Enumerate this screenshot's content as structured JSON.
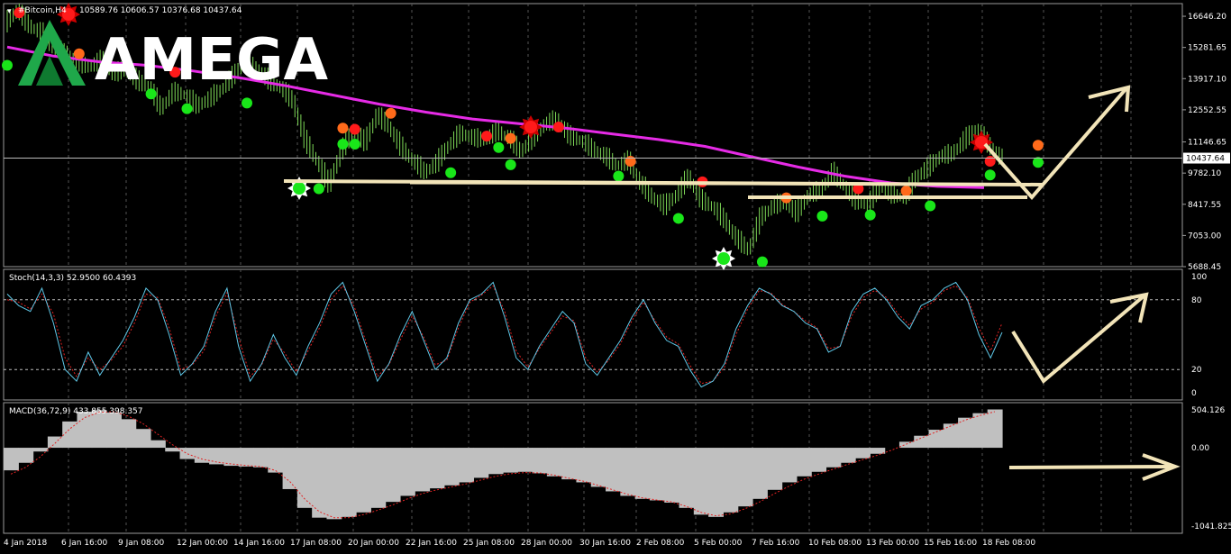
{
  "chart_data": [
    {
      "type": "candlestick",
      "symbol_label": "#Bitcoin,H4",
      "ohlc_text": "10589.76 10606.57 10376.68 10437.64",
      "current_price": "10437.64",
      "logo": {
        "text": "AMEGA",
        "accent": "#1fa84a"
      },
      "yaxis": {
        "ticks": [
          "16646.20",
          "15281.65",
          "13917.10",
          "12552.55",
          "11146.65",
          "9782.10",
          "8417.55",
          "7053.00",
          "5688.45"
        ],
        "range": [
          5688.45,
          17200
        ]
      },
      "price_series": [
        16300,
        16900,
        16200,
        15900,
        15200,
        15000,
        14600,
        14400,
        14700,
        14100,
        14300,
        13800,
        13500,
        12600,
        13300,
        13200,
        12700,
        13000,
        13400,
        14000,
        14600,
        14300,
        13800,
        13500,
        12900,
        11200,
        10300,
        9250,
        10700,
        11600,
        11100,
        12300,
        11800,
        10900,
        10300,
        9800,
        10200,
        11000,
        11500,
        11300,
        11200,
        11600,
        11300,
        10700,
        11300,
        11900,
        12100,
        11400,
        11200,
        10800,
        10500,
        10100,
        10300,
        9300,
        8700,
        8300,
        8800,
        9600,
        8600,
        8300,
        7700,
        6900,
        6400,
        7800,
        8300,
        8500,
        8000,
        8800,
        9000,
        9800,
        9200,
        8500,
        8400,
        9200,
        8800,
        8700,
        9600,
        10000,
        10500,
        10600,
        11200,
        11700,
        11000,
        10437
      ],
      "ma_series": [
        15300,
        14900,
        14650,
        14500,
        14250,
        13950,
        13600,
        13200,
        12800,
        12450,
        12150,
        11950,
        11750,
        11500,
        11250,
        10950,
        10500,
        10050,
        9650,
        9350,
        9200,
        9150
      ],
      "buy_signals": [
        {
          "i": 0,
          "p": 14500
        },
        {
          "i": 12,
          "p": 13250
        },
        {
          "i": 15,
          "p": 12600
        },
        {
          "i": 20,
          "p": 12850
        },
        {
          "i": 26,
          "p": 9100
        },
        {
          "i": 28,
          "p": 11050
        },
        {
          "i": 29,
          "p": 11050
        },
        {
          "i": 37,
          "p": 9800
        },
        {
          "i": 41,
          "p": 10900
        },
        {
          "i": 42,
          "p": 10150
        },
        {
          "i": 51,
          "p": 9650
        },
        {
          "i": 56,
          "p": 7800
        },
        {
          "i": 63,
          "p": 5900
        },
        {
          "i": 68,
          "p": 7900
        },
        {
          "i": 72,
          "p": 7950
        },
        {
          "i": 77,
          "p": 8350
        },
        {
          "i": 82,
          "p": 9700
        },
        {
          "i": 86,
          "p": 10250
        }
      ],
      "sell_signals": [
        {
          "i": 1,
          "p": 16800
        },
        {
          "i": 6,
          "p": 15000
        },
        {
          "i": 14,
          "p": 14200
        },
        {
          "i": 28,
          "p": 11750
        },
        {
          "i": 29,
          "p": 11700
        },
        {
          "i": 32,
          "p": 12400
        },
        {
          "i": 40,
          "p": 11400
        },
        {
          "i": 42,
          "p": 11300
        },
        {
          "i": 46,
          "p": 11800
        },
        {
          "i": 52,
          "p": 10300
        },
        {
          "i": 58,
          "p": 9400
        },
        {
          "i": 65,
          "p": 8700
        },
        {
          "i": 71,
          "p": 9100
        },
        {
          "i": 75,
          "p": 9000
        },
        {
          "i": 82,
          "p": 10300
        },
        {
          "i": 86,
          "p": 11000
        }
      ],
      "levels": [
        9500,
        9300,
        8900
      ]
    },
    {
      "type": "line",
      "title": "Stoch(14,3,3) 52.9500 60.4393",
      "yaxis": {
        "ticks": [
          "100",
          "80",
          "20",
          "0"
        ],
        "range": [
          0,
          100
        ]
      },
      "levels": [
        80,
        20
      ],
      "main_series": [
        85,
        75,
        70,
        90,
        60,
        20,
        10,
        35,
        15,
        30,
        45,
        65,
        90,
        80,
        50,
        15,
        25,
        40,
        70,
        90,
        40,
        10,
        25,
        50,
        30,
        15,
        40,
        60,
        85,
        95,
        70,
        40,
        10,
        25,
        50,
        70,
        45,
        20,
        30,
        60,
        80,
        85,
        95,
        65,
        30,
        20,
        40,
        55,
        70,
        60,
        25,
        15,
        30,
        45,
        65,
        80,
        60,
        45,
        40,
        20,
        5,
        10,
        25,
        55,
        75,
        90,
        85,
        75,
        70,
        60,
        55,
        35,
        40,
        70,
        85,
        90,
        80,
        65,
        55,
        75,
        80,
        90,
        95,
        80,
        50,
        30,
        52
      ],
      "signal_series": [
        80,
        78,
        72,
        85,
        68,
        30,
        14,
        30,
        20,
        28,
        40,
        60,
        85,
        82,
        56,
        20,
        24,
        36,
        65,
        86,
        48,
        14,
        24,
        46,
        34,
        18,
        36,
        56,
        80,
        92,
        74,
        44,
        14,
        24,
        46,
        66,
        48,
        24,
        28,
        56,
        78,
        84,
        92,
        70,
        36,
        22,
        38,
        52,
        66,
        62,
        30,
        18,
        28,
        42,
        62,
        78,
        62,
        48,
        42,
        24,
        8,
        10,
        22,
        50,
        72,
        88,
        86,
        76,
        70,
        62,
        56,
        38,
        40,
        66,
        82,
        88,
        82,
        68,
        58,
        72,
        78,
        88,
        92,
        82,
        56,
        36,
        60
      ],
      "legend": []
    },
    {
      "type": "bar",
      "title": "MACD(36,72,9) 433.855 398.357",
      "yaxis": {
        "ticks": [
          "504.126",
          "0.00",
          "-1041.825"
        ],
        "range": [
          -1041.825,
          504.126
        ]
      },
      "histogram": [
        -300,
        -200,
        -50,
        150,
        350,
        480,
        500,
        470,
        380,
        250,
        100,
        -50,
        -150,
        -200,
        -220,
        -240,
        -250,
        -260,
        -330,
        -550,
        -800,
        -930,
        -950,
        -920,
        -860,
        -800,
        -720,
        -640,
        -580,
        -540,
        -500,
        -460,
        -400,
        -350,
        -330,
        -320,
        -340,
        -380,
        -420,
        -460,
        -520,
        -580,
        -640,
        -680,
        -700,
        -730,
        -800,
        -890,
        -920,
        -860,
        -780,
        -680,
        -560,
        -460,
        -380,
        -320,
        -260,
        -200,
        -140,
        -80,
        0,
        80,
        160,
        240,
        320,
        400,
        460,
        510
      ],
      "signal": [
        -350,
        -260,
        -120,
        60,
        250,
        400,
        470,
        480,
        420,
        320,
        180,
        40,
        -80,
        -150,
        -190,
        -215,
        -235,
        -250,
        -300,
        -450,
        -680,
        -850,
        -930,
        -930,
        -890,
        -830,
        -760,
        -680,
        -610,
        -560,
        -520,
        -480,
        -430,
        -380,
        -345,
        -330,
        -335,
        -365,
        -405,
        -445,
        -500,
        -560,
        -620,
        -665,
        -695,
        -720,
        -780,
        -860,
        -905,
        -880,
        -810,
        -720,
        -610,
        -510,
        -420,
        -350,
        -285,
        -220,
        -160,
        -100,
        -30,
        50,
        130,
        210,
        290,
        370,
        430,
        480
      ],
      "legend": []
    }
  ],
  "xaxis": {
    "ticks": [
      "4 Jan 2018",
      "6 Jan 16:00",
      "9 Jan 08:00",
      "12 Jan 00:00",
      "14 Jan 16:00",
      "17 Jan 08:00",
      "20 Jan 00:00",
      "22 Jan 16:00",
      "25 Jan 08:00",
      "28 Jan 00:00",
      "30 Jan 16:00",
      "2 Feb 08:00",
      "5 Feb 00:00",
      "7 Feb 16:00",
      "10 Feb 08:00",
      "13 Feb 00:00",
      "15 Feb 16:00",
      "18 Feb 08:00"
    ]
  },
  "colors": {
    "background": "#000000",
    "candles": "#7ed957",
    "ma": "#e62be6",
    "buy_dot": "#19e619",
    "sell_dot_red": "#ff1a1a",
    "sell_dot_orange": "#ff6a1a",
    "drawings": "#f2e4b8",
    "stoch_main": "#5fc8e8",
    "stoch_signal": "#e22222",
    "macd_hist": "#c0c0c0",
    "macd_signal": "#e22222",
    "text": "#ffffff"
  }
}
